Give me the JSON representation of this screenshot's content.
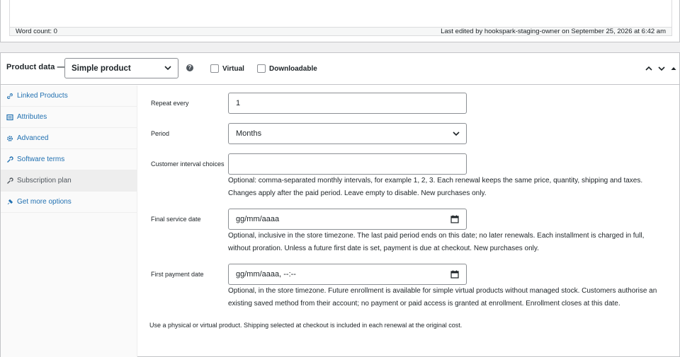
{
  "editor": {
    "word_count": "Word count: 0",
    "last_edited": "Last edited by hookspark-staging-owner on September 25, 2026 at 6:42 am"
  },
  "product_data": {
    "title": "Product data —",
    "type_selected": "Simple product",
    "virtual_label": "Virtual",
    "downloadable_label": "Downloadable",
    "virtual_checked": false,
    "downloadable_checked": false
  },
  "tabs": [
    {
      "label": "Linked Products",
      "icon": "link-icon"
    },
    {
      "label": "Attributes",
      "icon": "list-icon"
    },
    {
      "label": "Advanced",
      "icon": "gear-icon"
    },
    {
      "label": "Software terms",
      "icon": "wrench-icon"
    },
    {
      "label": "Subscription plan",
      "icon": "wrench-icon",
      "active": true
    },
    {
      "label": "Get more options",
      "icon": "plugin-icon"
    }
  ],
  "form": {
    "repeat_every": {
      "label": "Repeat every",
      "value": "1"
    },
    "period": {
      "label": "Period",
      "value": "Months"
    },
    "customer_interval": {
      "label": "Customer interval choices",
      "value": "",
      "description": "Optional: comma-separated monthly intervals, for example 1, 2, 3. Each renewal keeps the same price, quantity, shipping and taxes. Changes apply after the paid period. Leave empty to disable. New purchases only."
    },
    "final_service_date": {
      "label": "Final service date",
      "placeholder": "gg/mm/aaaa",
      "description": "Optional, inclusive in the store timezone. The last paid period ends on this date; no later renewals. Each installment is charged in full, without proration. Unless a future first date is set, payment is due at checkout. New purchases only."
    },
    "first_payment_date": {
      "label": "First payment date",
      "placeholder": "gg/mm/aaaa, --:--",
      "description": "Optional, in the store timezone. Future enrollment is available for simple virtual products without managed stock. Customers authorise an existing saved method from their account; no payment or paid access is granted at enrollment. Enrollment closes at this date."
    },
    "shipping_note": "Use a physical or virtual product. Shipping selected at checkout is included in each renewal at the original cost."
  }
}
